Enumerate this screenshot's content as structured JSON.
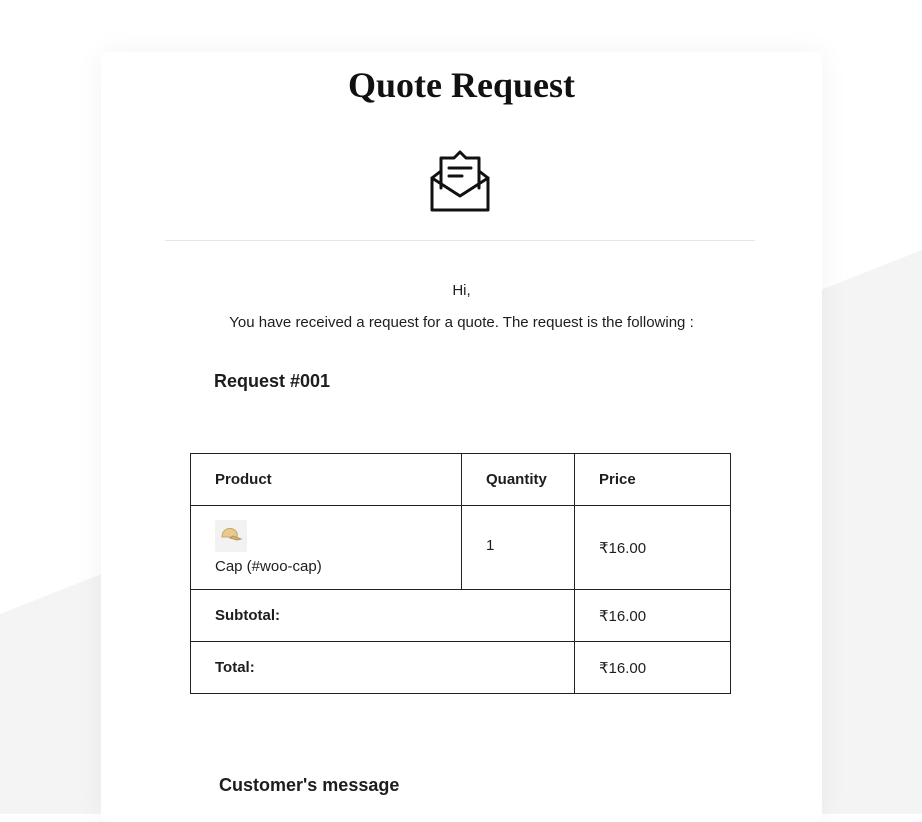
{
  "title": "Quote Request",
  "greeting": "Hi,",
  "intro": "You have received a request for a quote. The request is the following :",
  "request_title": "Request #001",
  "table": {
    "headers": {
      "product": "Product",
      "quantity": "Quantity",
      "price": "Price"
    },
    "items": [
      {
        "product": "Cap (#woo-cap)",
        "quantity": "1",
        "price": "₹16.00"
      }
    ],
    "subtotal_label": "Subtotal:",
    "subtotal_value": "₹16.00",
    "total_label": "Total:",
    "total_value": "₹16.00"
  },
  "customer_message_title": "Customer's message",
  "icons": {
    "header": "envelope-open-icon",
    "product_thumb": "cap-thumbnail"
  },
  "colors": {
    "background": "#ffffff",
    "background_shape": "#f4f4f4",
    "text": "#1d1d1d",
    "border": "#222222"
  }
}
